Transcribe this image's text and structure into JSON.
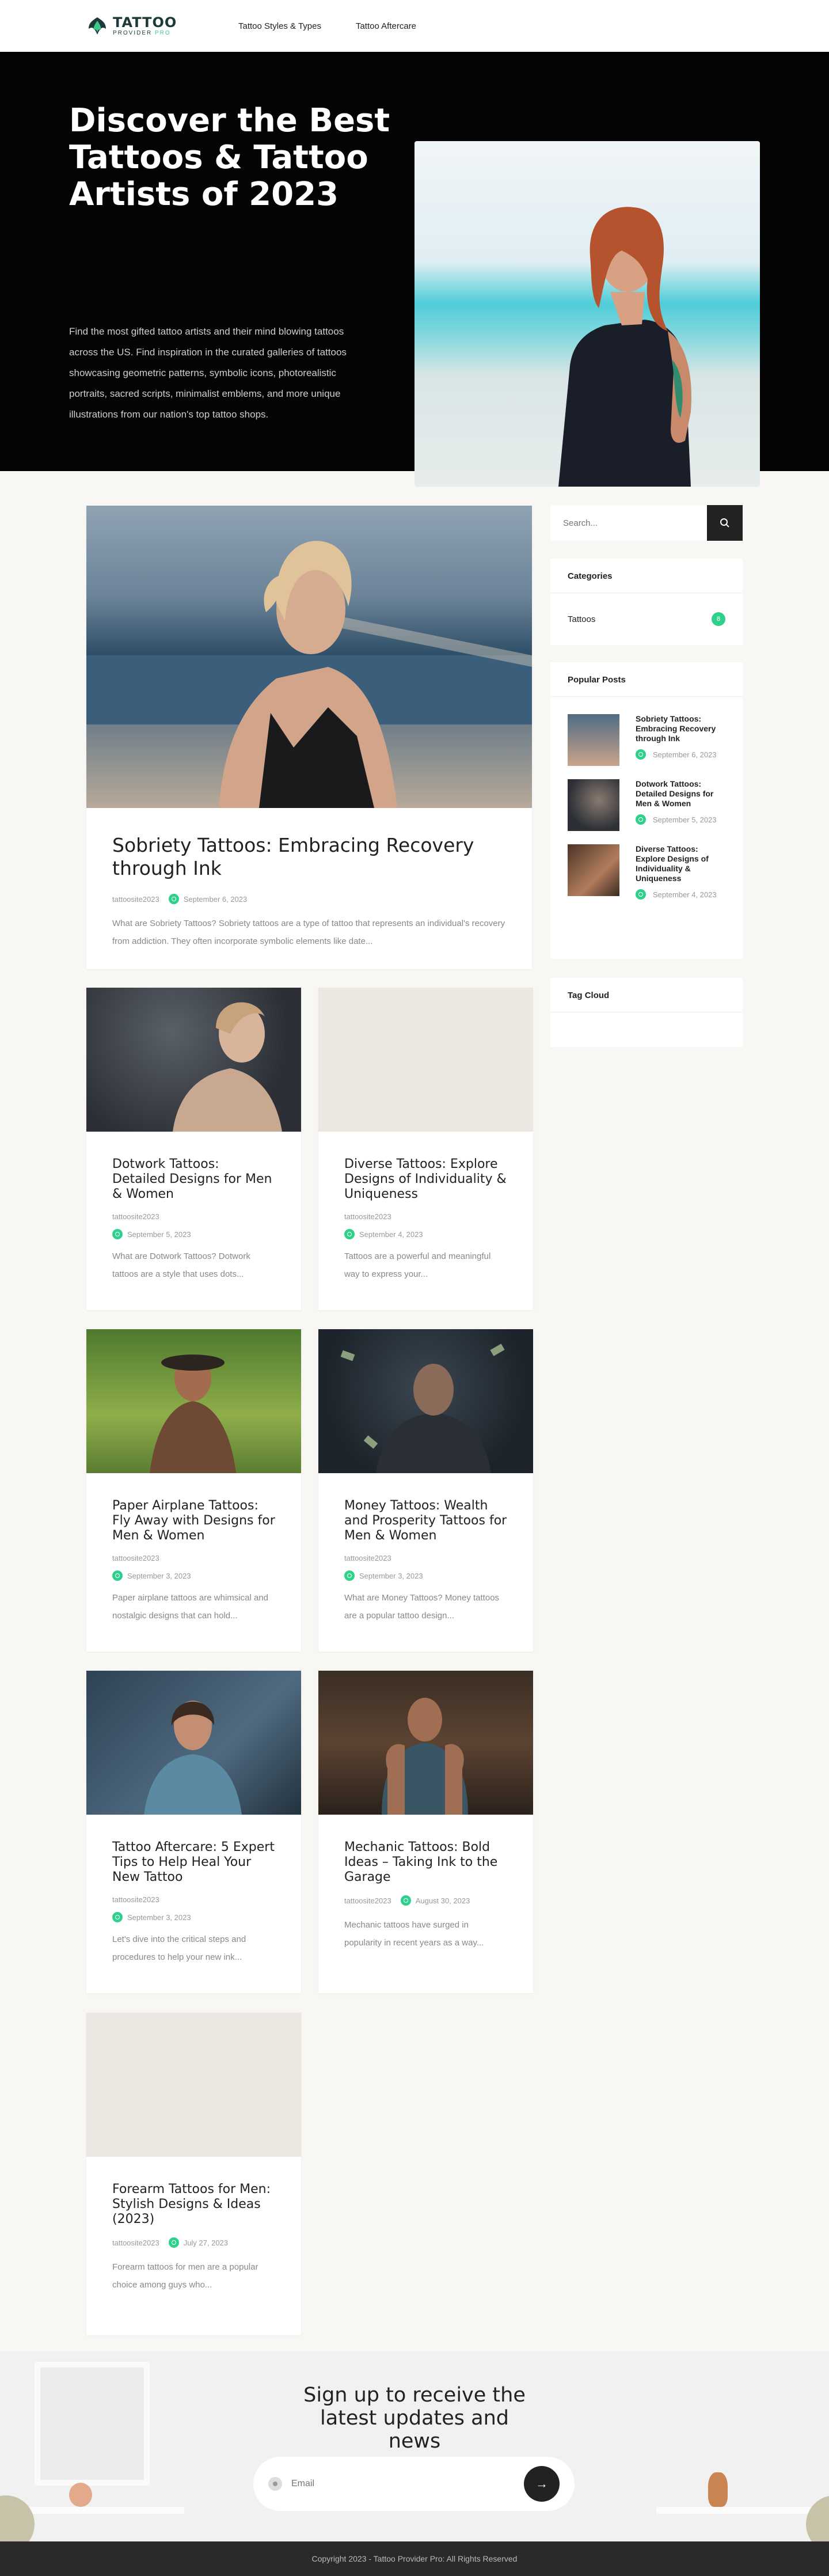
{
  "header": {
    "logo_text": "TATTOO",
    "logo_sub_1": "PROVIDER ",
    "logo_sub_2": "PRO",
    "nav": [
      "Tattoo Styles & Types",
      "Tattoo Aftercare"
    ]
  },
  "hero": {
    "title": "Discover the Best Tattoos & Tattoo Artists of 2023",
    "description": "Find the most gifted tattoo artists and their mind blowing tattoos across the US. Find inspiration in the curated galleries of tattoos showcasing geometric patterns, symbolic icons, photorealistic portraits, sacred scripts, minimalist emblems, and more unique illustrations from our nation's top tattoo shops."
  },
  "featured": {
    "title": "Sobriety Tattoos: Embracing Recovery through Ink",
    "author": "tattoosite2023",
    "date": "September 6, 2023",
    "excerpt": "What are Sobriety Tattoos? Sobriety tattoos are a type of tattoo that represents an individual's recovery from addiction. They often incorporate symbolic elements like date..."
  },
  "posts": [
    {
      "title": "Dotwork Tattoos: Detailed Designs for Men & Women",
      "author": "tattoosite2023",
      "date": "September 5, 2023",
      "excerpt": "What are Dotwork Tattoos? Dotwork tattoos are a style that uses dots..."
    },
    {
      "title": "Diverse Tattoos: Explore Designs of Individuality & Uniqueness",
      "author": "tattoosite2023",
      "date": "September 4, 2023",
      "excerpt": "Tattoos are a powerful and meaningful way to express your..."
    },
    {
      "title": "Paper Airplane Tattoos: Fly Away with Designs for Men & Women",
      "author": "tattoosite2023",
      "date": "September 3, 2023",
      "excerpt": "Paper airplane tattoos are whimsical and nostalgic designs that can hold..."
    },
    {
      "title": "Money Tattoos: Wealth and Prosperity Tattoos for Men & Women",
      "author": "tattoosite2023",
      "date": "September 3, 2023",
      "excerpt": "What are Money Tattoos? Money tattoos are a popular tattoo design..."
    },
    {
      "title": "Tattoo Aftercare: 5 Expert Tips to Help Heal Your New Tattoo",
      "author": "tattoosite2023",
      "date": "September 3, 2023",
      "excerpt": "Let's dive into the critical steps and procedures to help your new ink..."
    },
    {
      "title": "Mechanic Tattoos: Bold Ideas – Taking Ink to the Garage",
      "author": "tattoosite2023",
      "date": "August 30, 2023",
      "excerpt": "Mechanic tattoos have surged in popularity in recent years as a way..."
    },
    {
      "title": "Forearm Tattoos for Men: Stylish Designs & Ideas (2023)",
      "author": "tattoosite2023",
      "date": "July 27, 2023",
      "excerpt": "Forearm tattoos for men are a popular choice among guys who..."
    }
  ],
  "sidebar": {
    "search_placeholder": "Search...",
    "categories_title": "Categories",
    "categories": [
      {
        "name": "Tattoos",
        "count": "8"
      }
    ],
    "popular_title": "Popular Posts",
    "popular": [
      {
        "title": "Sobriety Tattoos: Embracing Recovery through Ink",
        "date": "September 6, 2023"
      },
      {
        "title": "Dotwork Tattoos: Detailed Designs for Men & Women",
        "date": "September 5, 2023"
      },
      {
        "title": "Diverse Tattoos: Explore Designs of Individuality & Uniqueness",
        "date": "September 4, 2023"
      }
    ],
    "tagcloud_title": "Tag Cloud"
  },
  "newsletter": {
    "title": "Sign up to receive the latest updates and news",
    "email_placeholder": "Email"
  },
  "footer": {
    "copyright": "Copyright 2023 - Tattoo Provider Pro: All Rights Reserved"
  },
  "colors": {
    "accent": "#2fd08b",
    "dark": "#040404"
  },
  "icons": [
    "logo-icon",
    "search-icon",
    "arrow-right-icon",
    "clock-icon",
    "email-icon"
  ]
}
